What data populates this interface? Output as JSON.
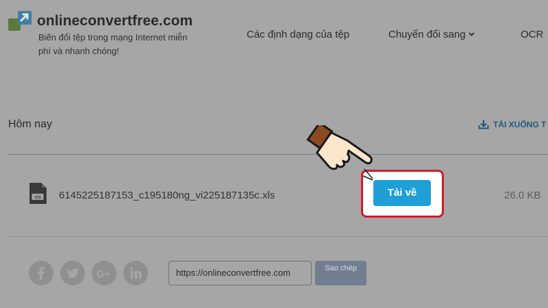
{
  "header": {
    "brand": "onlineconvertfree.com",
    "tagline": "Biến đổi tệp trong mạng Internet miễn phí và nhanh chóng!",
    "nav": {
      "formats": "Các định dạng của tệp",
      "convert": "Chuyển đổi sang",
      "ocr": "OCR"
    }
  },
  "results": {
    "section_title": "Hôm nay",
    "download_all": "TẢI XUỐNG T",
    "file": {
      "name": "6145225187153_c195180ng_vi225187135c.xls",
      "icon_label": "xls",
      "download_label": "Tải về",
      "size": "26.0 KB"
    }
  },
  "footer": {
    "social": [
      "facebook-icon",
      "twitter-icon",
      "google-plus-icon",
      "linkedin-icon"
    ],
    "url": "https://onlineconvertfree.com",
    "copy_label": "Sao chép"
  },
  "colors": {
    "overlay": "#a6a6a6",
    "download_button": "#1e9fd6",
    "highlight_border": "#d01b2a",
    "link": "#1d5a80"
  }
}
